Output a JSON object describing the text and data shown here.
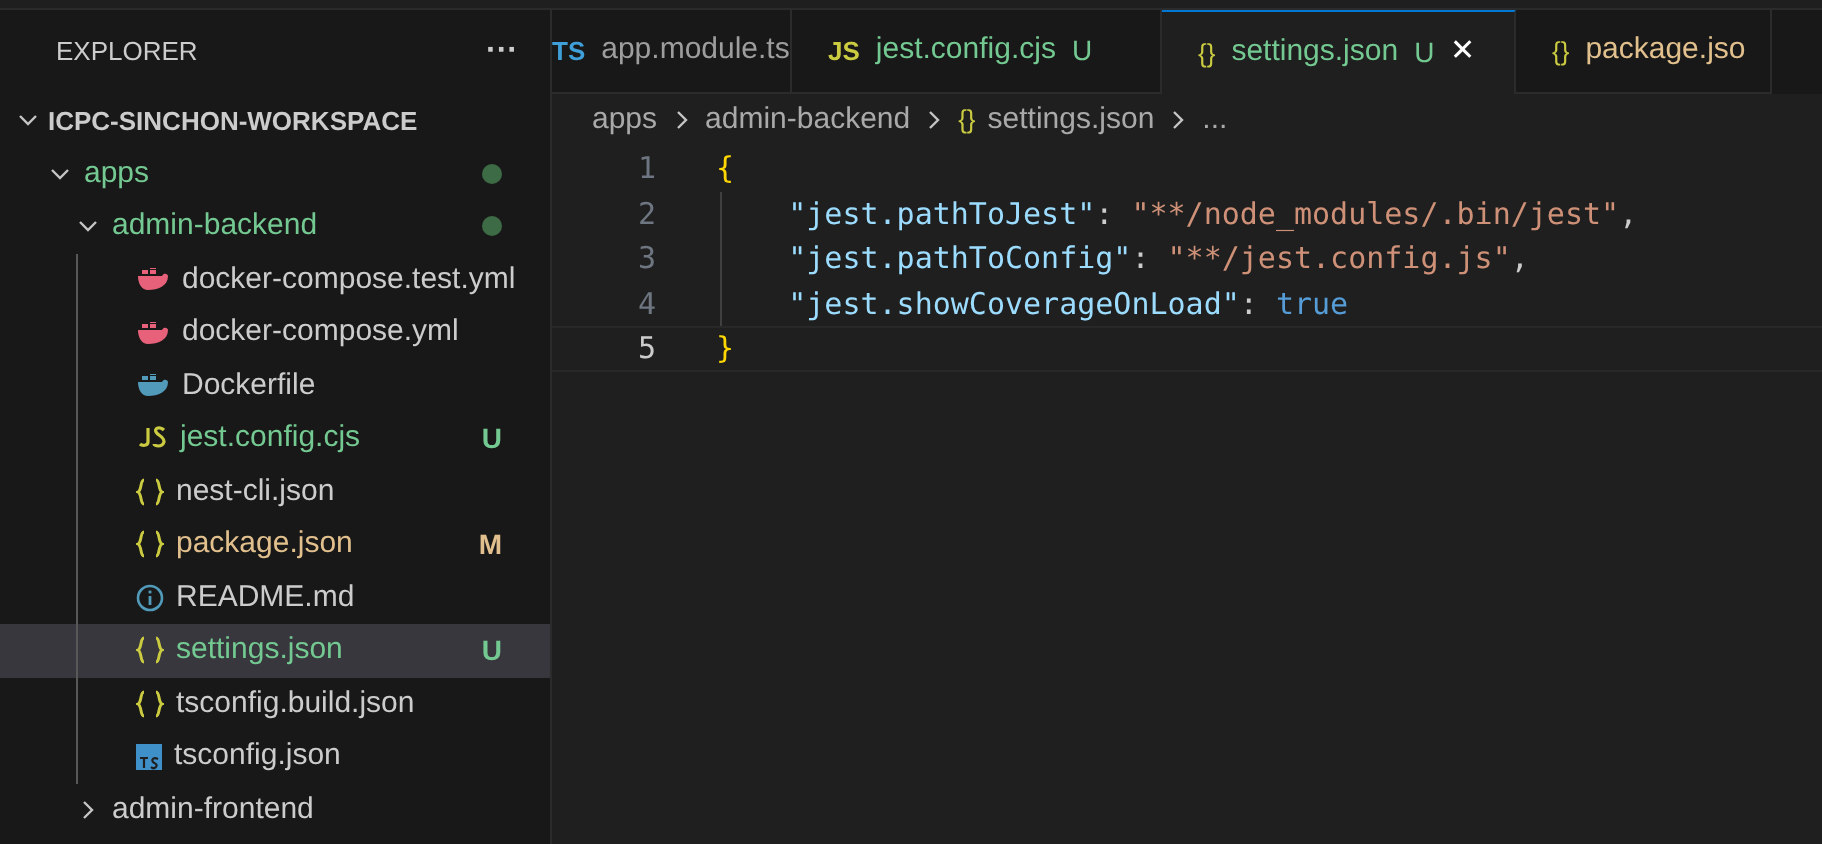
{
  "sidebar": {
    "title": "EXPLORER",
    "more": "···",
    "workspace": {
      "label": "ICPC-SINCHON-WORKSPACE",
      "expanded": true
    },
    "tree": [
      {
        "label": "apps",
        "kind": "folder",
        "expanded": true,
        "color": "#73c991",
        "changes_dot": true,
        "children": [
          {
            "label": "admin-backend",
            "kind": "folder",
            "expanded": true,
            "color": "#73c991",
            "changes_dot": true,
            "children": [
              {
                "label": "docker-compose.test.yml",
                "kind": "docker-compose",
                "selected": false
              },
              {
                "label": "docker-compose.yml",
                "kind": "docker-compose",
                "selected": false
              },
              {
                "label": "Dockerfile",
                "kind": "docker",
                "selected": false
              },
              {
                "label": "jest.config.cjs",
                "kind": "js",
                "color": "#73c991",
                "badge": "U",
                "selected": false
              },
              {
                "label": "nest-cli.json",
                "kind": "json",
                "selected": false
              },
              {
                "label": "package.json",
                "kind": "json",
                "color": "#e2c08d",
                "badge": "M",
                "selected": false
              },
              {
                "label": "README.md",
                "kind": "info",
                "selected": false
              },
              {
                "label": "settings.json",
                "kind": "json",
                "color": "#73c991",
                "badge": "U",
                "selected": true
              },
              {
                "label": "tsconfig.build.json",
                "kind": "json",
                "selected": false
              },
              {
                "label": "tsconfig.json",
                "kind": "ts",
                "selected": false
              }
            ]
          },
          {
            "label": "admin-frontend",
            "kind": "folder",
            "expanded": false
          }
        ]
      }
    ]
  },
  "tabs": [
    {
      "label": "app.module.ts",
      "icon": "TS",
      "kind": "ts",
      "selected": false
    },
    {
      "label": "jest.config.cjs",
      "icon": "JS",
      "kind": "js",
      "badge": "U",
      "color": "#73c991",
      "selected": false
    },
    {
      "label": "settings.json",
      "icon": "{}",
      "kind": "json",
      "badge": "U",
      "color": "#73c991",
      "selected": true,
      "close": "✕"
    },
    {
      "label": "package.jso",
      "icon": "{}",
      "kind": "json",
      "color": "#e2c08d",
      "selected": false
    }
  ],
  "breadcrumb": [
    {
      "label": "apps"
    },
    {
      "label": "admin-backend"
    },
    {
      "label": "settings.json",
      "icon": "{}"
    },
    {
      "label": "..."
    }
  ],
  "editor": {
    "lines": [
      {
        "number": "1",
        "current": false,
        "tokens": [
          {
            "kind": "brace",
            "text": "{"
          }
        ]
      },
      {
        "number": "2",
        "current": false,
        "tokens": [
          {
            "kind": "key",
            "text": "    \"jest.pathToJest\""
          },
          {
            "kind": "punct",
            "text": ": "
          },
          {
            "kind": "string",
            "text": "\"**/node_modules/.bin/jest\""
          },
          {
            "kind": "punct",
            "text": ","
          }
        ]
      },
      {
        "number": "3",
        "current": false,
        "tokens": [
          {
            "kind": "key",
            "text": "    \"jest.pathToConfig\""
          },
          {
            "kind": "punct",
            "text": ": "
          },
          {
            "kind": "string",
            "text": "\"**/jest.config.js\""
          },
          {
            "kind": "punct",
            "text": ","
          }
        ]
      },
      {
        "number": "4",
        "current": false,
        "tokens": [
          {
            "kind": "key",
            "text": "    \"jest.showCoverageOnLoad\""
          },
          {
            "kind": "punct",
            "text": ": "
          },
          {
            "kind": "bool",
            "text": "true"
          }
        ]
      },
      {
        "number": "5",
        "current": true,
        "tokens": [
          {
            "kind": "brace",
            "text": "}"
          }
        ]
      }
    ]
  }
}
